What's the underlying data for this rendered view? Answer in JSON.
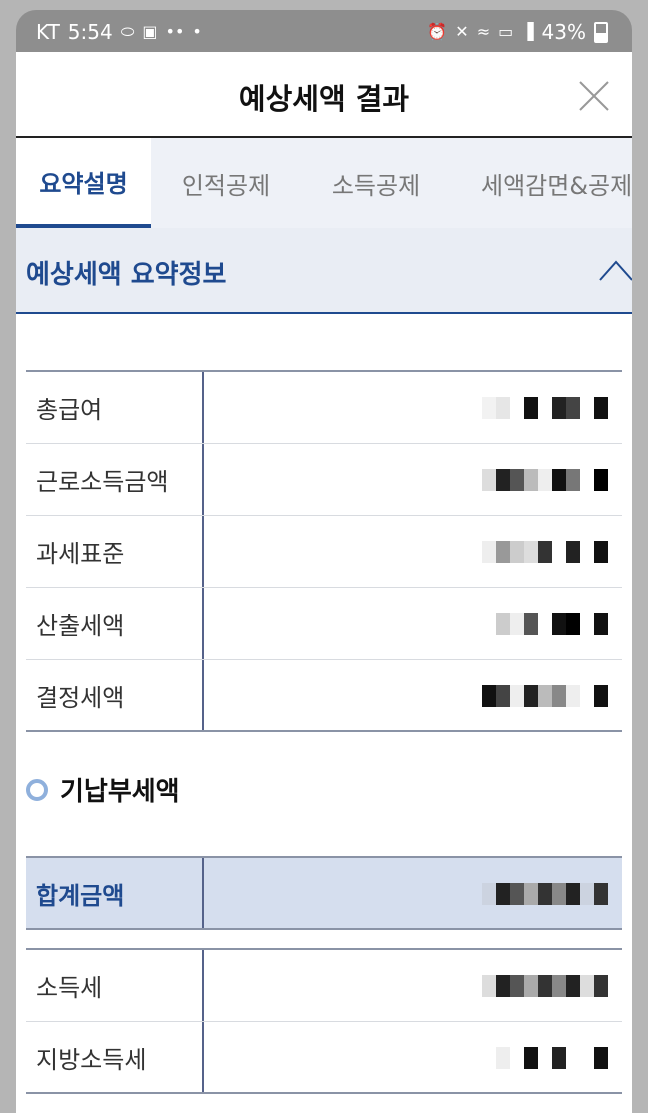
{
  "status_bar": {
    "carrier": "KT",
    "time": "5:54",
    "battery": "43%"
  },
  "modal": {
    "title": "예상세액 결과"
  },
  "tabs": [
    {
      "label": "요약설명",
      "active": true
    },
    {
      "label": "인적공제",
      "active": false
    },
    {
      "label": "소득공제",
      "active": false
    },
    {
      "label": "세액감면&공제",
      "active": false
    }
  ],
  "summary": {
    "title": "예상세액 요약정보",
    "rows": [
      {
        "label": "총급여"
      },
      {
        "label": "근로소득금액"
      },
      {
        "label": "과세표준"
      },
      {
        "label": "산출세액"
      },
      {
        "label": "결정세액"
      }
    ]
  },
  "prepaid": {
    "title": "기납부세액",
    "total_label": "합계금액",
    "rows": [
      {
        "label": "소득세"
      },
      {
        "label": "지방소득세"
      }
    ]
  },
  "colors": {
    "accent": "#1f4a8f",
    "highlight_row": "#d5deee"
  }
}
